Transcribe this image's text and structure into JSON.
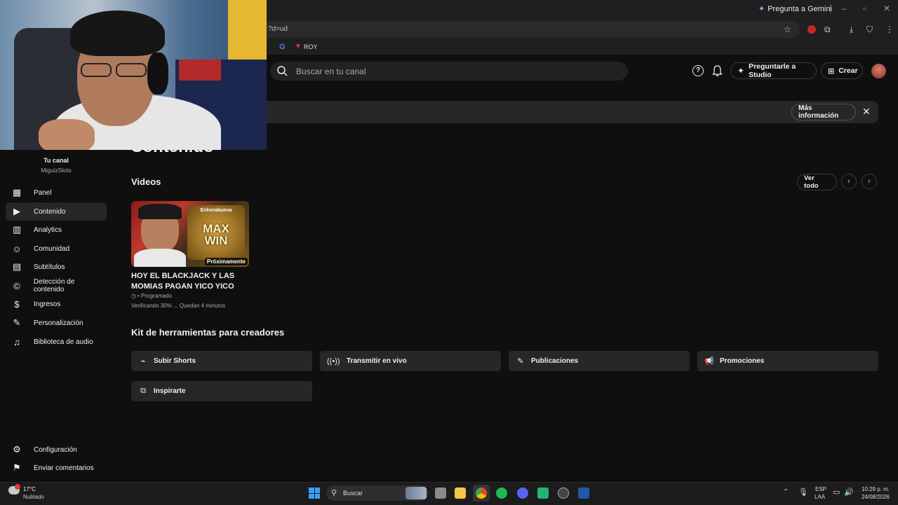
{
  "browser": {
    "gemini_label": "Pregunta a Gemini",
    "url": "?d=ud",
    "bookmark_label": "ROY"
  },
  "header": {
    "search_placeholder": "Buscar en tu canal",
    "ask_studio_label": "Preguntarle a Studio",
    "create_label": "Crear"
  },
  "banner": {
    "more_info_label": "Más información"
  },
  "sidebar": {
    "channel_title": "Tu canal",
    "channel_name": "MiguizSlots",
    "items": [
      {
        "label": "Panel",
        "icon": "dashboard-icon"
      },
      {
        "label": "Contenido",
        "icon": "content-icon"
      },
      {
        "label": "Analytics",
        "icon": "analytics-icon"
      },
      {
        "label": "Comunidad",
        "icon": "community-icon"
      },
      {
        "label": "Subtítulos",
        "icon": "subtitles-icon"
      },
      {
        "label": "Detección de contenido",
        "icon": "copyright-icon"
      },
      {
        "label": "Ingresos",
        "icon": "dollar-icon"
      },
      {
        "label": "Personalización",
        "icon": "magic-wand-icon"
      },
      {
        "label": "Biblioteca de audio",
        "icon": "audio-library-icon"
      }
    ],
    "bottom_items": [
      {
        "label": "Configuración",
        "icon": "gear-icon"
      },
      {
        "label": "Enviar comentarios",
        "icon": "feedback-icon"
      }
    ]
  },
  "main": {
    "page_title": "Contenido",
    "videos_title": "Videos",
    "see_all_label": "Ver todo",
    "video": {
      "title_line1": "HOY EL BLACKJACK Y LAS",
      "title_line2": "MOMIAS PAGAN YICO YICO",
      "status": "• Programado",
      "progress_text": "Verificando 30% ... Quedan 4 minutos",
      "badge": "Próximamente",
      "thumb_text_top": "Enhorabuena",
      "thumb_text_max": "MAX",
      "thumb_text_win": "WIN"
    },
    "toolkit_title": "Kit de herramientas para creadores",
    "tools": [
      {
        "label": "Subir Shorts",
        "icon": "shorts-icon"
      },
      {
        "label": "Transmitir en vivo",
        "icon": "live-icon"
      },
      {
        "label": "Publicaciones",
        "icon": "post-edit-icon"
      },
      {
        "label": "Promociones",
        "icon": "megaphone-icon"
      },
      {
        "label": "Inspirarte",
        "icon": "inspire-icon"
      }
    ]
  },
  "taskbar": {
    "temperature": "17°C",
    "weather": "Nublado",
    "search_label": "Buscar",
    "lang_top": "ESP",
    "lang_bottom": "LAA",
    "time": "10:29 p. m.",
    "date": "24/08/2026"
  },
  "colors": {
    "background": "#0f0f0f",
    "surface": "#272727",
    "text": "#f1f1f1"
  }
}
